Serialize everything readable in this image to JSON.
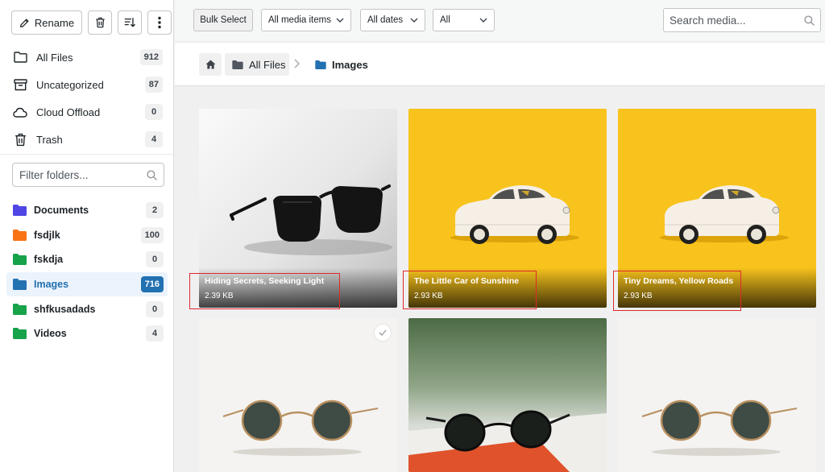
{
  "toolbar": {
    "rename_label": "Rename"
  },
  "system_folders": [
    {
      "label": "All Files",
      "count": "912",
      "icon": "folder-outline-icon"
    },
    {
      "label": "Uncategorized",
      "count": "87",
      "icon": "archive-icon"
    },
    {
      "label": "Cloud Offload",
      "count": "0",
      "icon": "cloud-icon"
    },
    {
      "label": "Trash",
      "count": "4",
      "icon": "trash-icon"
    }
  ],
  "filter": {
    "placeholder": "Filter folders..."
  },
  "folders": [
    {
      "label": "Documents",
      "count": "2",
      "color": "#4f46e5",
      "active": false
    },
    {
      "label": "fsdjlk",
      "count": "100",
      "color": "#f97316",
      "active": false
    },
    {
      "label": "fskdja",
      "count": "0",
      "color": "#16a34a",
      "active": false
    },
    {
      "label": "Images",
      "count": "716",
      "color": "#2271b1",
      "active": true
    },
    {
      "label": "shfkusadads",
      "count": "0",
      "color": "#16a34a",
      "active": false
    },
    {
      "label": "Videos",
      "count": "4",
      "color": "#16a34a",
      "active": false
    }
  ],
  "topbar": {
    "bulk_select": "Bulk Select",
    "media_filter": "All media items",
    "date_filter": "All dates",
    "type_filter": "All",
    "search_placeholder": "Search media..."
  },
  "breadcrumb": {
    "root": "All Files",
    "current": "Images"
  },
  "media": [
    {
      "title": "Hiding Secrets, Seeking Light",
      "size": "2.39 KB"
    },
    {
      "title": "The Little Car of Sunshine",
      "size": "2.93 KB"
    },
    {
      "title": "Tiny Dreams, Yellow Roads",
      "size": "2.93 KB"
    }
  ],
  "colors": {
    "accent": "#2271b1",
    "highlight": "#e0282b",
    "card_yellow": "#f8c31c"
  }
}
